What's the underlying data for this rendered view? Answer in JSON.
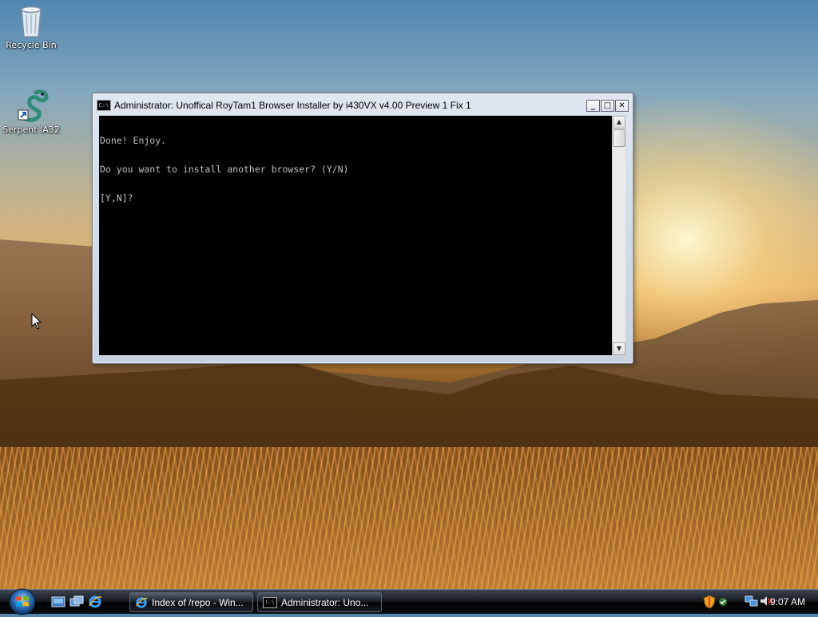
{
  "desktop": {
    "icons": [
      {
        "label": "Recycle Bin",
        "icon": "recycle-bin-icon"
      },
      {
        "label": "Serpent IA32",
        "icon": "serpent-icon"
      }
    ]
  },
  "window": {
    "title": "Administrator:  Unoffical RoyTam1 Browser Installer by i430VX v4.00 Preview 1 Fix 1",
    "icon_text": "C:\\",
    "buttons": {
      "minimize": "_",
      "maximize": "□",
      "close": "✕"
    },
    "console_lines": [
      "Done! Enjoy.",
      "Do you want to install another browser? (Y/N)",
      "[Y,N]?"
    ],
    "scroll_up": "▲",
    "scroll_down": "▼"
  },
  "taskbar": {
    "tasks": [
      {
        "label": "Index of /repo - Win...",
        "icon": "internet-explorer-icon"
      },
      {
        "label": "Administrator:  Uno...",
        "icon": "console-icon"
      }
    ],
    "clock": "9:07 AM"
  },
  "colors": {
    "console_bg": "#000000",
    "console_fg": "#c0c0c0",
    "taskbar": "#14181e"
  }
}
